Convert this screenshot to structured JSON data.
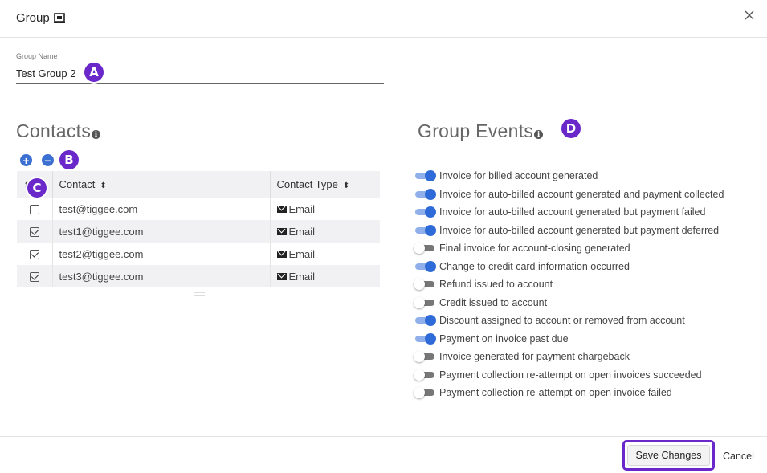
{
  "header": {
    "title": "Group",
    "title_icon": "group-icon",
    "close_icon": "close-icon"
  },
  "form": {
    "group_name_label": "Group Name",
    "group_name_value": "Test Group 2"
  },
  "annotations": {
    "a": "A",
    "b": "B",
    "c": "C",
    "d": "D"
  },
  "contacts": {
    "heading": "Contacts",
    "add_icon": "+",
    "remove_icon": "−",
    "columns": [
      "Contact",
      "Contact Type"
    ],
    "sort_icon": "⬍",
    "rows": [
      {
        "contact": "test@tiggee.com",
        "type": "Email",
        "checked": false
      },
      {
        "contact": "test1@tiggee.com",
        "type": "Email",
        "checked": true
      },
      {
        "contact": "test2@tiggee.com",
        "type": "Email",
        "checked": true
      },
      {
        "contact": "test3@tiggee.com",
        "type": "Email",
        "checked": true
      }
    ]
  },
  "events": {
    "heading": "Group Events",
    "items": [
      {
        "label": "Invoice for billed account generated",
        "enabled": true
      },
      {
        "label": "Invoice for auto-billed account generated and payment collected",
        "enabled": true
      },
      {
        "label": "Invoice for auto-billed account generated but payment failed",
        "enabled": true
      },
      {
        "label": "Invoice for auto-billed account generated but payment deferred",
        "enabled": true
      },
      {
        "label": "Final invoice for account-closing generated",
        "enabled": false
      },
      {
        "label": "Change to credit card information occurred",
        "enabled": true
      },
      {
        "label": "Refund issued to account",
        "enabled": false
      },
      {
        "label": "Credit issued to account",
        "enabled": false
      },
      {
        "label": "Discount assigned to account or removed from account",
        "enabled": true
      },
      {
        "label": "Payment on invoice past due",
        "enabled": true
      },
      {
        "label": "Invoice generated for payment chargeback",
        "enabled": false
      },
      {
        "label": "Payment collection re-attempt on open invoices succeeded",
        "enabled": false
      },
      {
        "label": "Payment collection re-attempt on open invoice failed",
        "enabled": false
      }
    ]
  },
  "footer": {
    "save_label": "Save Changes",
    "cancel_label": "Cancel"
  },
  "colors": {
    "accent": "#6a27c9",
    "toggle_on": "#2f6bd8",
    "button_blue": "#3b6fd1"
  }
}
